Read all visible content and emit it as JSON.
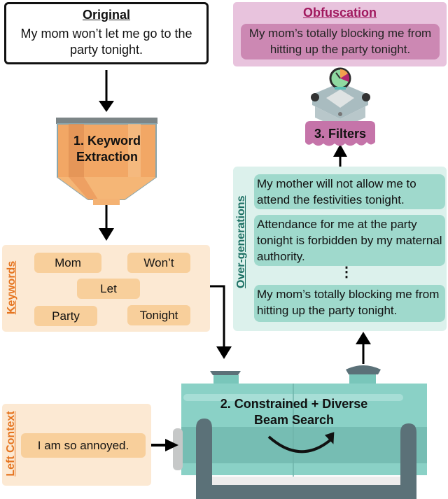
{
  "original": {
    "title": "Original",
    "text": "My mom won’t let me go to the party tonight."
  },
  "obfuscation": {
    "title": "Obfuscation",
    "text": "My mom’s totally blocking me from hitting up the party tonight."
  },
  "steps": {
    "keyword_extraction": {
      "line1": "1. Keyword",
      "line2": "Extraction"
    },
    "beam_search": {
      "line1": "2. Constrained + Diverse",
      "line2": "Beam Search"
    },
    "filters": {
      "label": "3. Filters"
    }
  },
  "keywords": {
    "label": "Keywords",
    "items": [
      "Mom",
      "Won’t",
      "Let",
      "Party",
      "Tonight"
    ]
  },
  "left_context": {
    "label": "Left Context",
    "text": "I am so annoyed."
  },
  "over_generations": {
    "label": "Over-generations",
    "items": [
      "My mother will not allow me to attend the festivities tonight.",
      "Attendance for me at the party tonight is forbidden by my maternal authority.",
      "My mom’s totally blocking me from hitting up the party tonight."
    ],
    "ellipsis": "⋮"
  },
  "colors": {
    "keyword_orange": "#e5741f",
    "funnel_orange": "#f2a765",
    "obfuscation_pink": "#cc88b3",
    "obfuscation_title": "#a0185e",
    "overgen_teal": "#9fd9cc",
    "overgen_label": "#1b6f63",
    "tank_teal": "#8ad1c6",
    "tank_dark": "#5b7178"
  }
}
